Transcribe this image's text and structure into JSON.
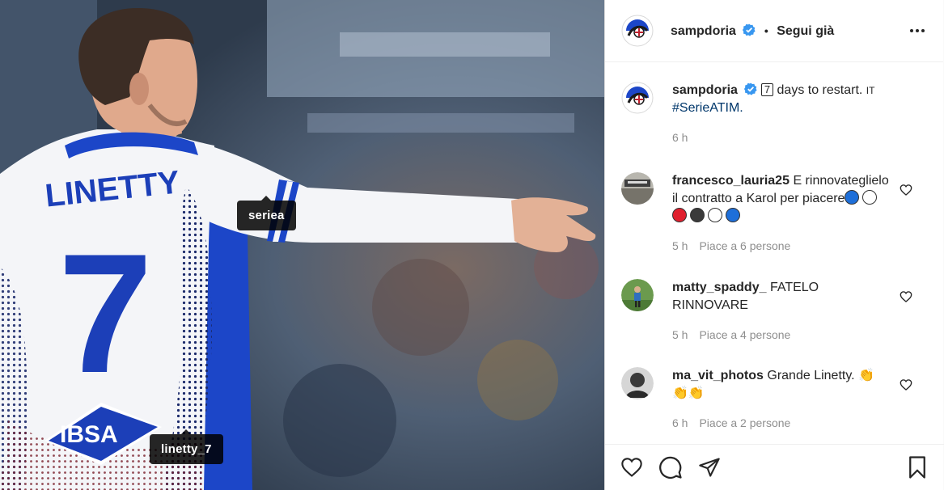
{
  "post": {
    "username": "sampdoria",
    "follow_state": "Segui già",
    "separator": "•",
    "photo_tags": [
      "seriea",
      "linetty_7"
    ],
    "jersey": {
      "name": "LINETTY",
      "number": "7",
      "sponsor": "IBSA"
    }
  },
  "caption": {
    "username": "sampdoria",
    "key": "7",
    "text": "days to restart.",
    "flag": "IT",
    "hashtag": "#SerieATIM.",
    "time": "6 h"
  },
  "comments": [
    {
      "username": "francesco_lauria25",
      "text": "E rinnovateglielo il contratto a Karol per piacere",
      "emoji_balls": [
        "#1e6fd9",
        "#ffffff",
        "#e0202e",
        "#3a3a3a",
        "#ffffff",
        "#1e6fd9"
      ],
      "time": "5 h",
      "likes": "Piace a 6 persone"
    },
    {
      "username": "matty_spaddy_",
      "text": "FATELO RINNOVARE",
      "time": "5 h",
      "likes": "Piace a 4 persone"
    },
    {
      "username": "ma_vit_photos",
      "text": "Grande Linetty.",
      "time": "6 h",
      "likes": "Piace a 2 persone"
    }
  ],
  "icons": {
    "verified": "verified-badge-icon",
    "more": "more-options-icon",
    "like": "heart-icon",
    "comment": "comment-icon",
    "share": "paper-plane-icon",
    "save": "bookmark-icon"
  },
  "colors": {
    "verified": "#3897f0",
    "hashtag": "#00376b",
    "meta": "#8e8e8e"
  }
}
